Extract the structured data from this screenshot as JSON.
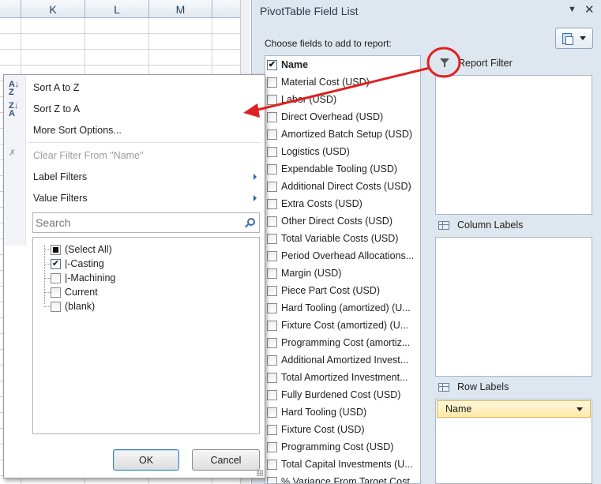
{
  "spreadsheet": {
    "columns": [
      "K",
      "L",
      "M"
    ]
  },
  "pivot_pane": {
    "title": "PivotTable Field List",
    "choose_label": "Choose fields to add to report:",
    "fields": [
      {
        "label": "Name",
        "checked": true
      },
      {
        "label": "Material Cost (USD)",
        "checked": false
      },
      {
        "label": "Labor (USD)",
        "checked": false
      },
      {
        "label": "Direct Overhead (USD)",
        "checked": false
      },
      {
        "label": "Amortized Batch Setup (USD)",
        "checked": false
      },
      {
        "label": "Logistics (USD)",
        "checked": false
      },
      {
        "label": "Expendable Tooling (USD)",
        "checked": false
      },
      {
        "label": "Additional Direct Costs (USD)",
        "checked": false
      },
      {
        "label": "Extra Costs (USD)",
        "checked": false
      },
      {
        "label": "Other Direct Costs (USD)",
        "checked": false
      },
      {
        "label": "Total Variable Costs (USD)",
        "checked": false
      },
      {
        "label": "Period Overhead Allocations...",
        "checked": false
      },
      {
        "label": "Margin (USD)",
        "checked": false
      },
      {
        "label": "Piece Part Cost (USD)",
        "checked": false
      },
      {
        "label": "Hard Tooling (amortized) (U...",
        "checked": false
      },
      {
        "label": "Fixture Cost (amortized) (U...",
        "checked": false
      },
      {
        "label": "Programming Cost (amortiz...",
        "checked": false
      },
      {
        "label": "Additional Amortized Invest...",
        "checked": false
      },
      {
        "label": "Total Amortized Investment...",
        "checked": false
      },
      {
        "label": "Fully Burdened Cost (USD)",
        "checked": false
      },
      {
        "label": "Hard Tooling (USD)",
        "checked": false
      },
      {
        "label": "Fixture Cost (USD)",
        "checked": false
      },
      {
        "label": "Programming Cost (USD)",
        "checked": false
      },
      {
        "label": "Total Capital Investments (U...",
        "checked": false
      },
      {
        "label": "% Variance From Target Cost",
        "checked": false
      }
    ],
    "areas": {
      "report_filter": "Report Filter",
      "column_labels": "Column Labels",
      "row_labels": "Row Labels",
      "row_field": "Name"
    }
  },
  "filter_menu": {
    "sort_az": "Sort A to Z",
    "sort_za": "Sort Z to A",
    "more_sort": "More Sort Options...",
    "clear_filter": "Clear Filter From \"Name\"",
    "label_filters": "Label Filters",
    "value_filters": "Value Filters",
    "search_placeholder": "Search",
    "values": [
      {
        "label": "(Select All)",
        "state": "partial"
      },
      {
        "label": "|-Casting",
        "state": "checked"
      },
      {
        "label": "|-Machining",
        "state": "unchecked"
      },
      {
        "label": "Current",
        "state": "unchecked"
      },
      {
        "label": "(blank)",
        "state": "unchecked"
      }
    ],
    "ok_label": "OK",
    "cancel_label": "Cancel"
  },
  "colors": {
    "annotation": "#e02020",
    "pane_bg": "#dee6ef",
    "row_field_bg": "#fde9a8"
  }
}
